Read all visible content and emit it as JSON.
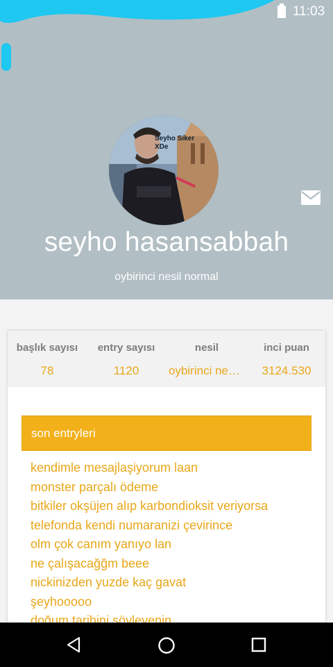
{
  "status_bar": {
    "time": "11:03",
    "battery_icon": "battery-icon",
    "scribble_color": "#1ec8f0"
  },
  "profile": {
    "name": "seyho hasansabbah",
    "rank": "oybirinci nesil normal",
    "avatar_caption": "Seyho Siker XDe",
    "mail_icon": "mail-icon"
  },
  "stats": [
    {
      "label": "başlık sayısı",
      "value": "78"
    },
    {
      "label": "entry sayısı",
      "value": "1120"
    },
    {
      "label": "nesil",
      "value": "oybirinci nesi..."
    },
    {
      "label": "inci puan",
      "value": "3124.530"
    }
  ],
  "recent": {
    "title": "son entryleri",
    "items": [
      "kendimle mesajlaşiyorum laan",
      "monster parçalı ödeme",
      "bitkiler okşüjen alıp karbondioksit veriyorsa",
      "telefonda kendi numaranizi çevirince",
      "olm çok canım yanıyo lan",
      "ne çalışacağğm beee",
      "nickinizden yuzde kaç gavat",
      "şeyhooooo",
      "doğum tarihini söyleyenin"
    ]
  },
  "nav": {
    "back": "back-icon",
    "home": "home-icon",
    "recents": "recents-icon"
  },
  "colors": {
    "header_bg": "#b1bec4",
    "accent": "#f2b01a",
    "accent_text": "#e8a71a"
  }
}
